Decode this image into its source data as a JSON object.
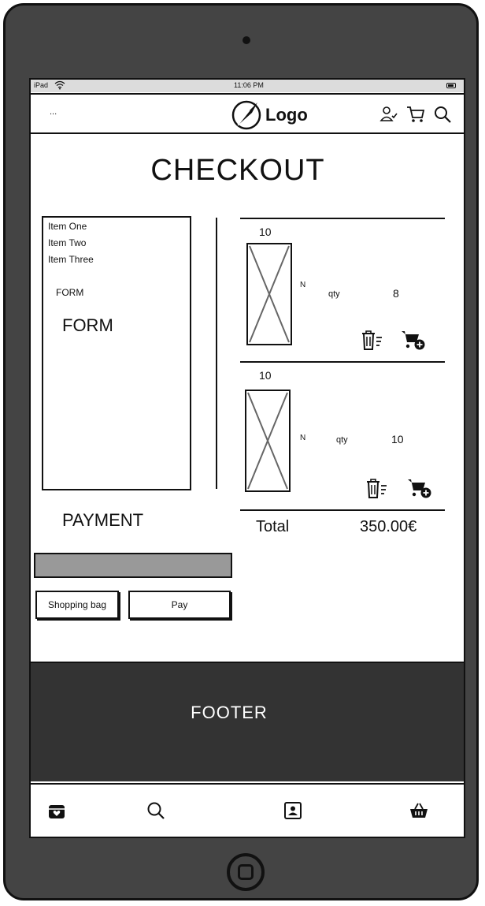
{
  "status": {
    "carrier": "iPad",
    "time": "11:06 PM"
  },
  "navbar": {
    "menu_label": "...",
    "logo_text": "Logo"
  },
  "page": {
    "title": "CHECKOUT"
  },
  "menu": {
    "items": [
      {
        "label": "Item One"
      },
      {
        "label": "Item Two"
      },
      {
        "label": "Item Three"
      }
    ],
    "form_small": "FORM",
    "form_big": "FORM"
  },
  "cart": {
    "items": [
      {
        "price": "10",
        "name": "N",
        "qty_label": "qty",
        "qty": "8"
      },
      {
        "price": "10",
        "name": "N",
        "qty_label": "qty",
        "qty": "10"
      }
    ],
    "total_label": "Total",
    "total_value": "350.00€"
  },
  "payment": {
    "title": "PAYMENT",
    "shopping_bag_label": "Shopping bag",
    "pay_label": "Pay"
  },
  "footer": {
    "label": "FOOTER"
  },
  "icons": {
    "navbar": [
      "user-check-icon",
      "cart-icon",
      "search-icon"
    ],
    "cart_item": [
      "trash-icon",
      "cart-add-icon"
    ],
    "tabbar": [
      "gift-box-icon",
      "search-icon",
      "contact-card-icon",
      "basket-icon"
    ]
  }
}
